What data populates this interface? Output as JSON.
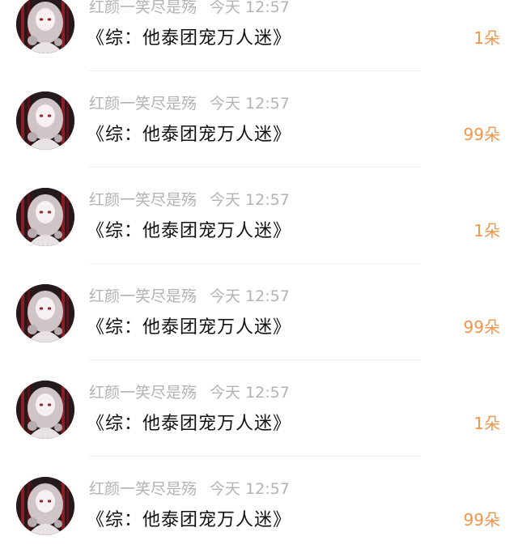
{
  "messages": [
    {
      "sender": "红颜一笑尽是殇",
      "time": "今天 12:57",
      "title": "《综：他泰团宠万人迷》",
      "count": "1朵"
    },
    {
      "sender": "红颜一笑尽是殇",
      "time": "今天 12:57",
      "title": "《综：他泰团宠万人迷》",
      "count": "99朵"
    },
    {
      "sender": "红颜一笑尽是殇",
      "time": "今天 12:57",
      "title": "《综：他泰团宠万人迷》",
      "count": "1朵"
    },
    {
      "sender": "红颜一笑尽是殇",
      "time": "今天 12:57",
      "title": "《综：他泰团宠万人迷》",
      "count": "99朵"
    },
    {
      "sender": "红颜一笑尽是殇",
      "time": "今天 12:57",
      "title": "《综：他泰团宠万人迷》",
      "count": "1朵"
    },
    {
      "sender": "红颜一笑尽是殇",
      "time": "今天 12:57",
      "title": "《综：他泰团宠万人迷》",
      "count": "99朵"
    }
  ],
  "colors": {
    "count_accent": "#f0954a",
    "meta_text": "#b3b3b3",
    "title_text": "#111111"
  },
  "icons": {
    "avatar": "avatar-illustration"
  }
}
